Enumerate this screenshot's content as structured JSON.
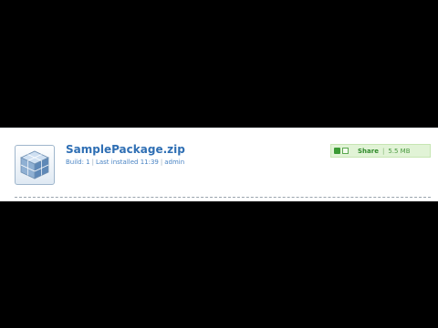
{
  "package": {
    "name": "SamplePackage.zip",
    "build_label": "Build: 1",
    "installed_label": "Last installed 11:39",
    "user": "admin",
    "separator": "|",
    "icon": "package-cube-icon"
  },
  "share_bar": {
    "label": "Share",
    "separator": "|",
    "size": "5.5 MB",
    "icons": [
      "share-icon",
      "document-icon"
    ]
  },
  "colors": {
    "page_background": "#000000",
    "panel_background": "#ffffff",
    "title": "#2f6fb4",
    "meta": "#4a84c4",
    "share_background": "#e1f3d6",
    "share_text": "#2f8a2a"
  }
}
